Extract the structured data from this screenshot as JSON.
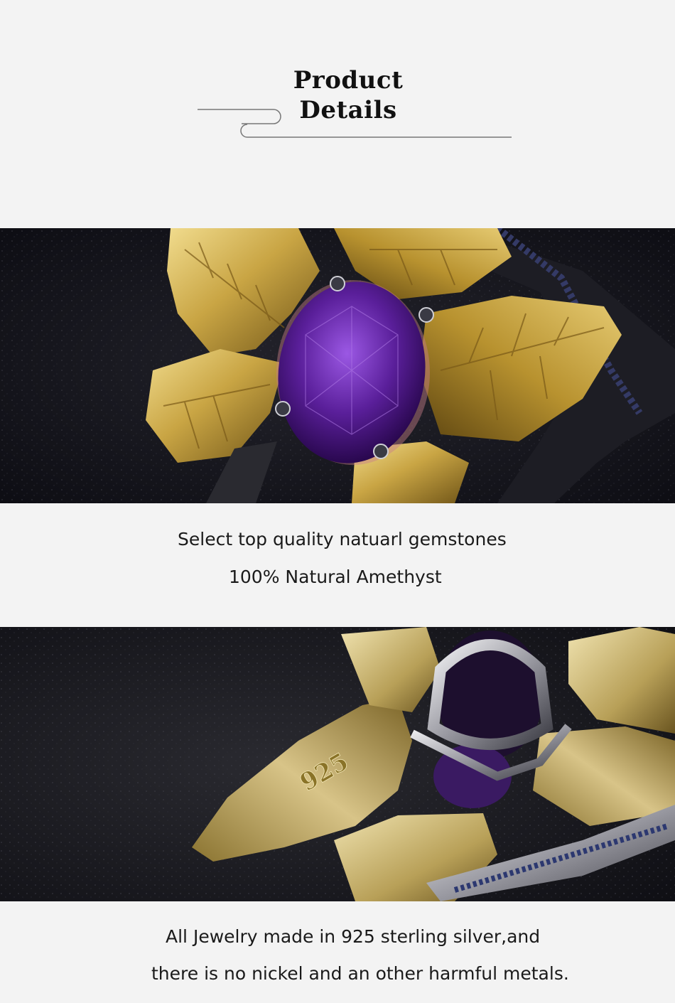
{
  "header": {
    "title_line1": "Product",
    "title_line2": "Details"
  },
  "section1": {
    "line1": "Select top quality natuarl gemstones",
    "line2": "100% Natural Amethyst"
  },
  "section2": {
    "line1": "All Jewelry made in 925 sterling silver,and",
    "line2": "there is no nickel and an other harmful metals."
  },
  "photo2": {
    "stamp": "925"
  },
  "colors": {
    "page_bg": "#f3f3f3",
    "amethyst": "#5a1f9a",
    "gold": "#c8a646",
    "velvet": "#14141a"
  },
  "icons": {
    "header_decoration": "wave-line-icon"
  }
}
